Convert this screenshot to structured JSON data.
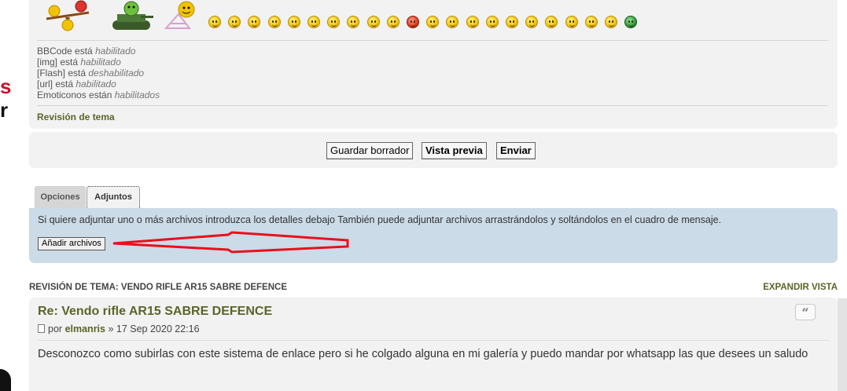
{
  "smilies": {
    "large": [
      "seesaw-smiley",
      "tank-smiley",
      "beach-smiley"
    ],
    "row_count": 22,
    "row_colors": [
      "yellow",
      "yellow",
      "yellow",
      "yellow",
      "yellow",
      "yellow",
      "yellow",
      "yellow",
      "yellow",
      "yellow",
      "red",
      "yellow",
      "yellow",
      "yellow",
      "yellow",
      "yellow",
      "yellow",
      "yellow",
      "yellow",
      "yellow",
      "yellow",
      "green"
    ]
  },
  "status": {
    "bbcode": {
      "label": "BBCode está",
      "value": "habilitado"
    },
    "img": {
      "label": "[img] está",
      "value": "habilitado"
    },
    "flash": {
      "label": "[Flash] está",
      "value": "deshabilitado"
    },
    "url": {
      "label": "[url] está",
      "value": "habilitado"
    },
    "emoticons": {
      "label": "Emoticonos están",
      "value": "habilitados"
    }
  },
  "review_link": "Revisión de tema",
  "buttons": {
    "save_draft": "Guardar borrador",
    "preview": "Vista previa",
    "submit": "Enviar"
  },
  "tabs": {
    "options": "Opciones",
    "attachments": "Adjuntos"
  },
  "attachments": {
    "help": "Si quiere adjuntar uno o más archivos introduzca los detalles debajo También puede adjuntar archivos arrastrándolos y soltándolos en el cuadro de mensaje.",
    "add_button": "Añadir archivos"
  },
  "topic_review": {
    "heading": "REVISIÓN DE TEMA: VENDO RIFLE AR15 SABRE DEFENCE",
    "expand": "EXPANDIR VISTA",
    "post": {
      "title": "Re: Vendo rifle AR15 SABRE DEFENCE",
      "by": "por",
      "author": "elmanris",
      "date": "» 17 Sep 2020 22:16",
      "body": "Desconozco como subirlas con este sistema de enlace pero si he colgado alguna en mi galería y puedo mandar por whatsapp las que desees un saludo"
    }
  },
  "colors": {
    "panel": "#f2f2f2",
    "attach_panel": "#cbdbe8",
    "link_olive": "#5b6428",
    "annotation_arrow": "#e8101c"
  }
}
